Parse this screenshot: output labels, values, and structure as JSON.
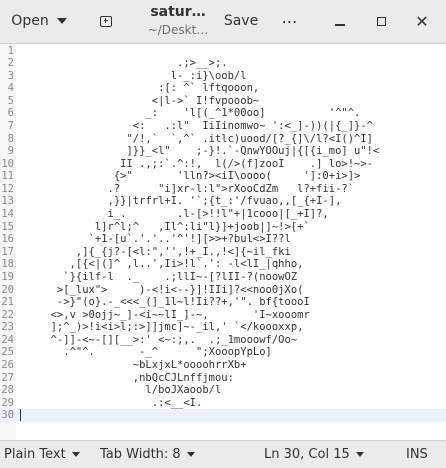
{
  "header": {
    "open_label": "Open",
    "save_label": "Save",
    "menu_label": "⋯",
    "title": "satur…",
    "subtitle": "~/Deskt…",
    "close_glyph": "✕"
  },
  "editor": {
    "cursor_line": 30,
    "line_numbers": [
      "1",
      "2",
      "3",
      "4",
      "5",
      "6",
      "7",
      "8",
      "9",
      "10",
      "11",
      "12",
      "13",
      "14",
      "15",
      "16",
      "17",
      "18",
      "19",
      "20",
      "21",
      "22",
      "23",
      "24",
      "25",
      "26",
      "27",
      "28",
      "29",
      "30"
    ],
    "lines": [
      "",
      "                         .;>__>;.",
      "                        l-_:i}\\oob/l",
      "                      :[: ^` lftqooon,",
      "                     <|l->` I!fvpooob~",
      "                    _:    'l[(_^1*00oo]          '^\"^.",
      "                  <:   .:l\"  IiIinomwo~ ':<_]-))(|{_]}-^",
      "                 \"/!,`  `,^` .itlc)uood/[?_{]\\/l?<I()^I]",
      "                 ]}}_<l\"    ;-}!.`-QnwYOOuj|{[{i_mo] u\"!<",
      "                II .,;:`.^:!,  l(/>(f]zooI    .] lo>!~>-",
      "               {>\"       'lln?><iI\\oooo(     ']:0+i>]>",
      "              .?      \"i]xr-l:l\">rXooCdZm   l?+fii-?`",
      "              ,}}|trfrl+I. '`;{t_:'/fvuao,,[_{+I-],",
      "              i_.        .l-[>!!l\"+|1cooo|[_+I]?,",
      "            l]r^l;^   ,Il^:li\"l}]+joob|]~!>[+`",
      "           `+1-[u`.'.'..'^'!][>>+?bul<>I??l",
      "         ,]{_{j?-[<l:\",'',!+_I.,!<]{~il_fki",
      "        ,[{<|(]^ ,l..',Ii>!l`.': -l<lI_|qhho,",
      "       `}{ilf-l  ._    .;llI~-[?lII-?(noowOZ",
      "      >[_lux\">     )-<!i<--}]!IIi]?<<noo0jXo(",
      "      ->}\"(o}.-_<<<_(]_1l~l!Ii??+,'\". bf{toooI",
      "     <>,v >0ojj~_]-<i~~lI_]-~,       'I~xooomr",
      "     ];^_)>!i<i>l;:>]]jmc]~-_il,' `</koooxxp,",
      "     ^-]]-<~-[][__>:' <~:;,.  .;_1mooowf/Oo~",
      "       .^\"^.       -_^      \";XooopYpLo]",
      "                  ~bLxjxL*oooohrrXb+",
      "                  ,nbQcCJLnffjmou:",
      "                    l/boJXaoob/l",
      "                     .:<__<I.",
      ""
    ]
  },
  "status": {
    "language": "Plain Text",
    "tab_width": "Tab Width: 8",
    "position": "Ln 30, Col 15",
    "mode": "INS"
  }
}
